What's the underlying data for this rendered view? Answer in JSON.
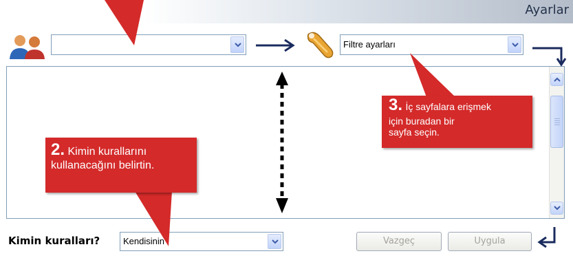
{
  "window": {
    "title": "Ayarlar"
  },
  "user_combo": {
    "value": ""
  },
  "filter_combo": {
    "value": "Filtre ayarları"
  },
  "whose_rules": {
    "label": "Kimin kuralları?",
    "value": "Kendisinin"
  },
  "buttons": {
    "cancel": "Vazgeç",
    "apply": "Uygula"
  },
  "callouts": {
    "step2": {
      "number": "2.",
      "line1": "Kimin kurallarını",
      "line2": "kullanacağını belirtin."
    },
    "step3": {
      "number": "3.",
      "line1": "İç sayfalara erişmek",
      "line2": "için buradan bir",
      "line3": "sayfa seçin."
    }
  },
  "icons": {
    "users": "users-icon",
    "wrench": "wrench-icon",
    "dropdown": "chevron-down-icon"
  },
  "colors": {
    "callout": "#d42a2a",
    "arrow": "#1a2b5e",
    "accent": "#24324a"
  }
}
